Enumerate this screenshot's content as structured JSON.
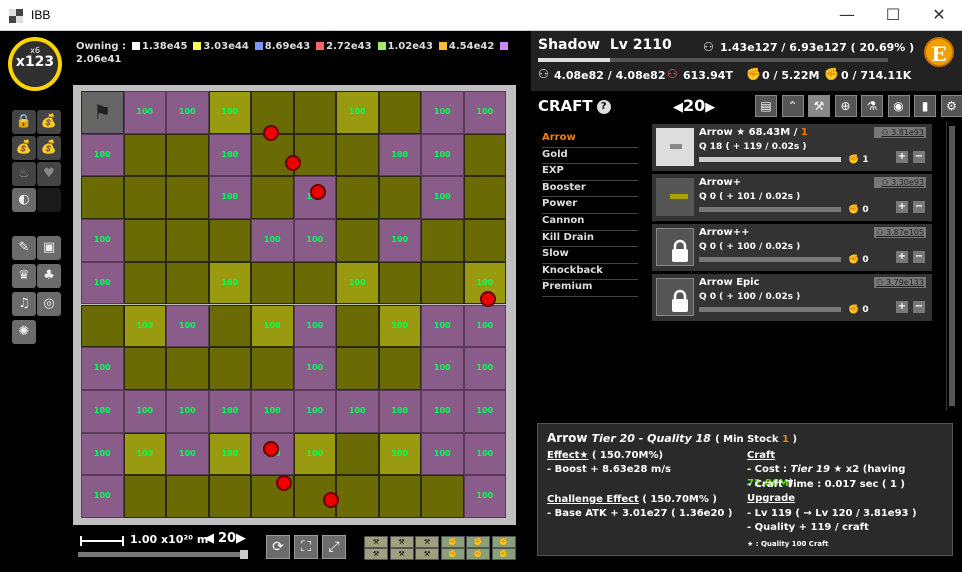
{
  "window": {
    "title": "IBB",
    "minimize": "—",
    "maximize": "☐",
    "close": "✕"
  },
  "badge": {
    "multiplier": "x6",
    "level": "x123"
  },
  "owning": {
    "label": "Owning :",
    "items": [
      {
        "color": "#ffffff",
        "value": "1.38e45"
      },
      {
        "color": "#ffff55",
        "value": "3.03e44"
      },
      {
        "color": "#7799ff",
        "value": "8.69e43"
      },
      {
        "color": "#ff6666",
        "value": "2.72e43"
      },
      {
        "color": "#99ee66",
        "value": "1.02e43"
      },
      {
        "color": "#ffbb33",
        "value": "4.54e42"
      },
      {
        "color": "#cc88ff",
        "value": "2.06e41"
      }
    ]
  },
  "board": {
    "value": "100",
    "rows": [
      "gppyooyopp",
      "poopoooppo",
      "ooopopoopo",
      "poooppopoo",
      "pooyooyooy",
      "oypoypoypp",
      "poooopoopp",
      "pppppppppp",
      "pypypyoypp",
      "poooooooop"
    ],
    "balls": [
      [
        4.5,
        1.0
      ],
      [
        5.0,
        1.7
      ],
      [
        5.6,
        2.4
      ],
      [
        9.6,
        4.9
      ],
      [
        4.5,
        8.4
      ],
      [
        4.8,
        9.2
      ],
      [
        5.9,
        9.6
      ]
    ]
  },
  "bottom": {
    "zoom_text": "1.00 x10²⁰ m",
    "speed": "20"
  },
  "character": {
    "name": "Shadow",
    "level": "Lv 2110",
    "xp": "1.43e127 / 6.93e127 ( 20.69% )",
    "xp_fraction": 0.2069,
    "hp": "4.08e82 / 4.08e82",
    "gold": "613.94T",
    "stat3": "0 / 5.22M",
    "stat4": "0 / 714.11K",
    "coin": "E"
  },
  "craft": {
    "header": "CRAFT",
    "help": "?",
    "tier": "20",
    "tabs": [
      "▤",
      "⌃",
      "⚒",
      "⊕",
      "⚗",
      "◉",
      "▮",
      "⚙"
    ],
    "categories": [
      "Arrow",
      "Gold",
      "EXP",
      "Booster",
      "Power",
      "Cannon",
      "Kill Drain",
      "Slow",
      "Knockback",
      "Premium"
    ],
    "items": [
      {
        "name": "Arrow ★ 68.43M / ",
        "stock": "1",
        "q": "Q 18  ( + 119 / 0.02s )",
        "count": "1",
        "cost": "3.81e93",
        "locked": false,
        "progress": 1.0
      },
      {
        "name": "Arrow+",
        "stock": "",
        "q": "Q 0  ( + 101 / 0.02s )",
        "count": "0",
        "cost": "3.30e93",
        "locked": false,
        "progress": 0
      },
      {
        "name": "Arrow++",
        "stock": "",
        "q": "Q 0  ( + 100 / 0.02s )",
        "count": "0",
        "cost": "3.87e105",
        "locked": true,
        "progress": 0
      },
      {
        "name": "Arrow Epic",
        "stock": "",
        "q": "Q 0  ( + 100 / 0.02s )",
        "count": "0",
        "cost": "3.79e133",
        "locked": true,
        "progress": 0
      }
    ]
  },
  "detail": {
    "title": "Arrow",
    "subtitle": "Tier 20 - Quality 18",
    "min_stock_label": "( Min Stock",
    "min_stock": "1",
    "min_stock_end": ")",
    "effect_head": "Effect★",
    "effect_pct": " ( 150.70M%)",
    "effect_line": "- Boost + 8.63e28 m/s",
    "challenge_head": "Challenge Effect",
    "challenge_pct": " ( 150.70M% )",
    "challenge_line": "- Base ATK + 3.01e27 ( 1.36e20 )",
    "craft_head": "Craft",
    "cost_label": "- Cost :",
    "cost_tier": "Tier 19",
    "cost_rest": "★ x2 (having",
    "having": "72.86M",
    "cost_end": ")",
    "craft_time": "- Craft Time : 0.017 sec  (  1 )",
    "upgrade_head": "Upgrade",
    "upgrade_lv": "- Lv 119  (  → Lv 120 /  3.81e93 )",
    "upgrade_quality": "- Quality + 119 / craft",
    "footnote": "★ : Quality 100 Craft"
  }
}
